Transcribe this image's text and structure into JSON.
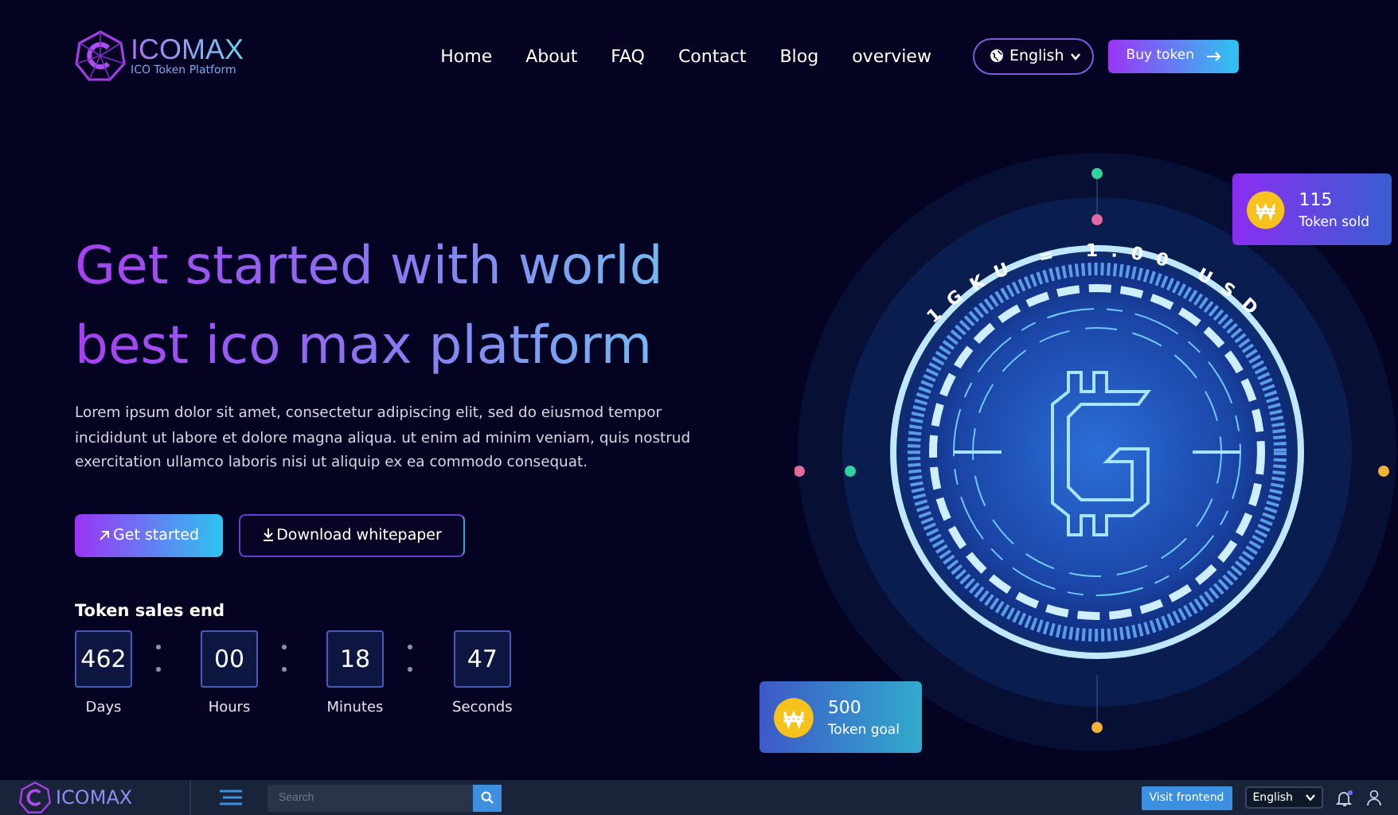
{
  "brand": {
    "name": "ICOMAX",
    "tagline": "ICO Token Platform"
  },
  "nav": [
    {
      "label": "Home"
    },
    {
      "label": "About"
    },
    {
      "label": "FAQ"
    },
    {
      "label": "Contact"
    },
    {
      "label": "Blog"
    },
    {
      "label": "overview"
    }
  ],
  "language": "English",
  "buy_button": "Buy token",
  "hero": {
    "title_line1": "Get started with world",
    "title_line2": "best ico max platform",
    "description": "Lorem ipsum dolor sit amet, consectetur adipiscing elit, sed do eiusmod tempor incididunt ut labore et dolore magna aliqua. ut enim ad minim veniam, quis nostrud exercitation ullamco laboris nisi ut aliquip ex ea commodo consequat.",
    "primary_button": "Get started",
    "secondary_button": "Download whitepaper"
  },
  "countdown": {
    "title": "Token sales end",
    "units": [
      {
        "value": "462",
        "label": "Days"
      },
      {
        "value": "00",
        "label": "Hours"
      },
      {
        "value": "18",
        "label": "Minutes"
      },
      {
        "value": "47",
        "label": "Seconds"
      }
    ]
  },
  "coin": {
    "rate": "1GKU = 1.00 USD"
  },
  "stats": [
    {
      "value": "115",
      "label": "Token sold"
    },
    {
      "value": "500",
      "label": "Token goal"
    }
  ],
  "admin_bar": {
    "brand": "ICOMAX",
    "search": {
      "placeholder": "Search"
    },
    "visit_button": "Visit frontend",
    "language": "English"
  }
}
